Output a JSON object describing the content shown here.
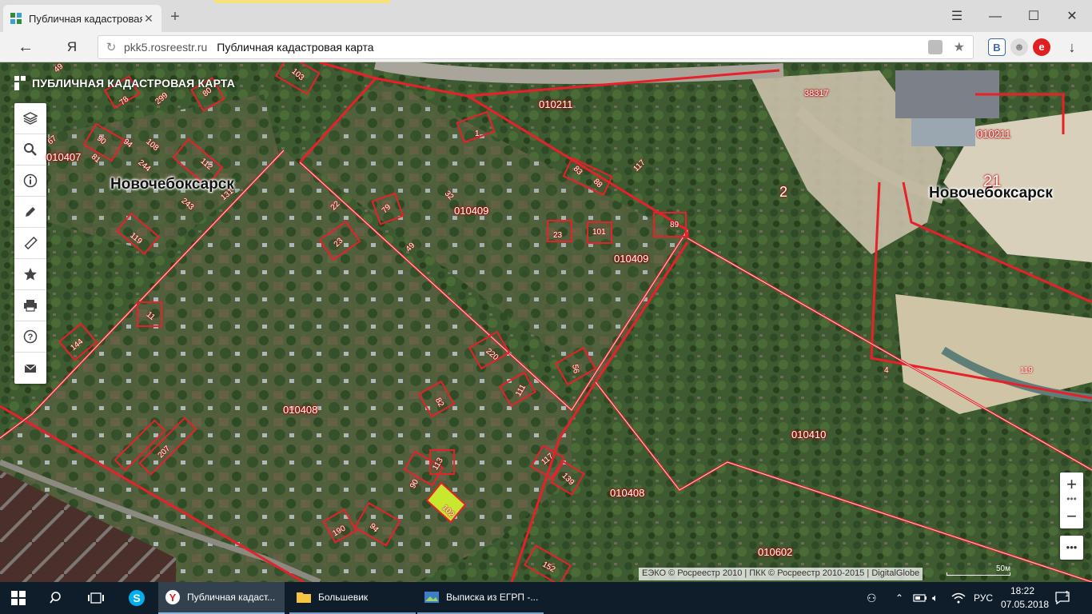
{
  "browser": {
    "tab_title": "Публичная кадастровая",
    "tab_close": "✕",
    "new_tab": "+",
    "window_menu": "☰",
    "minimize": "—",
    "maximize": "☐",
    "close": "✕",
    "back": "←",
    "yandex_button": "Я",
    "reload": "↻",
    "url_domain": "pkk5.rosreestr.ru",
    "page_title": "Публичная кадастровая карта",
    "ext_vk": "В",
    "ext_red": "e",
    "download": "↓"
  },
  "map": {
    "brand_title": "ПУБЛИЧНАЯ КАДАСТРОВАЯ КАРТА",
    "toolbar": [
      {
        "name": "layers-icon"
      },
      {
        "name": "search-icon"
      },
      {
        "name": "info-icon"
      },
      {
        "name": "pencil-icon"
      },
      {
        "name": "ruler-icon"
      },
      {
        "name": "star-icon"
      },
      {
        "name": "print-icon"
      },
      {
        "name": "help-icon"
      },
      {
        "name": "mail-icon"
      }
    ],
    "city_labels": [
      "Новочебоксарск",
      "Новочебоксарск"
    ],
    "quarter_labels": [
      "010211",
      "010211",
      "010409",
      "010409",
      "010408",
      "010410",
      "010408",
      "010602",
      "010407",
      "38317"
    ],
    "big_numbers": [
      "2",
      "21"
    ],
    "plot_numbers": [
      "49",
      "103",
      "78",
      "299",
      "80",
      "67",
      "90",
      "81",
      "94",
      "108",
      "244",
      "112",
      "131",
      "243",
      "119",
      "11",
      "144",
      "207",
      "1",
      "83",
      "88",
      "117",
      "32",
      "79",
      "22",
      "23",
      "49",
      "23",
      "101",
      "89",
      "220",
      "56",
      "111",
      "82",
      "113",
      "90",
      "102",
      "190",
      "94",
      "117",
      "139",
      "152",
      "4",
      "119"
    ],
    "zoom_in": "+",
    "zoom_out": "−",
    "zoom_dots": "•••",
    "more": "•••",
    "attribution": "ЕЭКО © Росреестр 2010 | ПКК © Росреестр 2010-2015 | DigitalGlobe",
    "scale_label": "50м",
    "highlight_color": "#c8e830",
    "boundary_color": "#e8202a"
  },
  "taskbar": {
    "apps": [
      {
        "label": "Публичная кадаст..."
      },
      {
        "label": "Большевик"
      },
      {
        "label": "Выписка из ЕГРП -..."
      }
    ],
    "lang": "РУС",
    "time": "18:22",
    "date": "07.05.2018",
    "notifications": "1"
  }
}
